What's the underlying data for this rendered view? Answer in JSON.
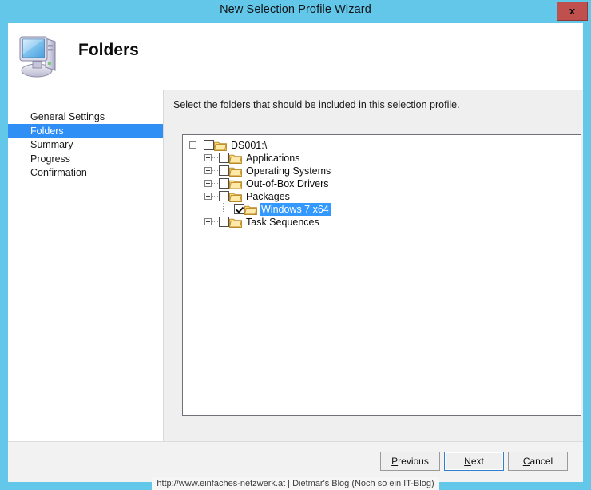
{
  "window": {
    "title": "New Selection Profile Wizard",
    "close_label": "x",
    "title_bar_color": "#63c7e9",
    "close_button_color": "#c0504d"
  },
  "header": {
    "icon": "computer-icon",
    "page_title": "Folders"
  },
  "sidebar": {
    "selected_index": 1,
    "highlight_color": "#2f8ff5",
    "items": [
      {
        "label": "General Settings"
      },
      {
        "label": "Folders"
      },
      {
        "label": "Summary"
      },
      {
        "label": "Progress"
      },
      {
        "label": "Confirmation"
      }
    ]
  },
  "content": {
    "instruction": "Select the folders that should be included in this selection profile."
  },
  "tree": {
    "selection_color": "#3399ff",
    "nodes": [
      {
        "label": "DS001:\\",
        "depth": 0,
        "toggle": "minus",
        "checked": false,
        "selected": false,
        "icon": "folder-icon"
      },
      {
        "label": "Applications",
        "depth": 1,
        "toggle": "plus",
        "checked": false,
        "selected": false,
        "icon": "folder-icon"
      },
      {
        "label": "Operating Systems",
        "depth": 1,
        "toggle": "plus",
        "checked": false,
        "selected": false,
        "icon": "folder-icon"
      },
      {
        "label": "Out-of-Box Drivers",
        "depth": 1,
        "toggle": "plus",
        "checked": false,
        "selected": false,
        "icon": "folder-icon"
      },
      {
        "label": "Packages",
        "depth": 1,
        "toggle": "minus",
        "checked": false,
        "selected": false,
        "icon": "folder-icon"
      },
      {
        "label": "Windows 7 x64",
        "depth": 2,
        "toggle": "none",
        "checked": true,
        "selected": true,
        "icon": "folder-icon"
      },
      {
        "label": "Task Sequences",
        "depth": 1,
        "toggle": "plus",
        "checked": false,
        "selected": false,
        "icon": "folder-icon"
      }
    ]
  },
  "footer": {
    "buttons": [
      {
        "label": "Previous",
        "accel": "P",
        "default": false
      },
      {
        "label": "Next",
        "accel": "N",
        "default": true
      },
      {
        "label": "Cancel",
        "accel": "C",
        "default": false
      }
    ]
  },
  "watermark": {
    "text": "http://www.einfaches-netzwerk.at | Dietmar's Blog (Noch so ein IT-Blog)"
  }
}
